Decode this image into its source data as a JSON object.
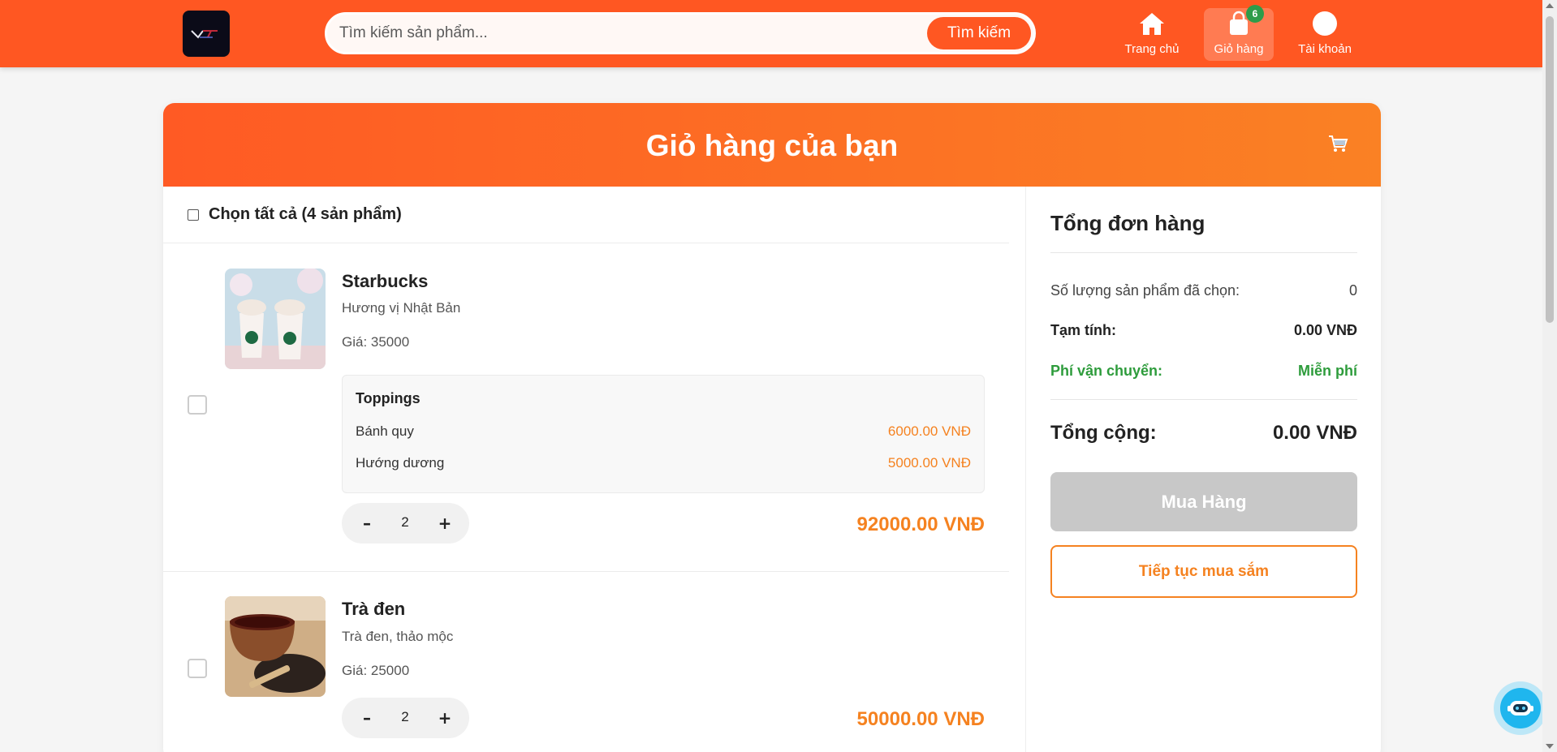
{
  "header": {
    "search": {
      "placeholder": "Tìm kiếm sản phẩm...",
      "button_label": "Tìm kiếm"
    },
    "nav": [
      {
        "label": "Trang chủ",
        "icon": "home-icon"
      },
      {
        "label": "Giỏ hàng",
        "icon": "shopping-bag-icon",
        "badge": "6"
      },
      {
        "label": "Tài khoản",
        "icon": "account-icon"
      }
    ],
    "brand_color": "#ff5722"
  },
  "cart": {
    "title": "Giỏ hàng của bạn",
    "select_all_label": "Chọn tất cả (4 sản phẩm)",
    "items": [
      {
        "name": "Starbucks",
        "description": "Hương vị Nhật Bản",
        "price_label": "Giá: 35000",
        "toppings_title": "Toppings",
        "toppings": [
          {
            "name": "Bánh quy",
            "price": "6000.00 VNĐ"
          },
          {
            "name": "Hướng dương",
            "price": "5000.00 VNĐ"
          }
        ],
        "quantity": "2",
        "total": "92000.00 VNĐ"
      },
      {
        "name": "Trà đen",
        "description": "Trà đen, thảo mộc",
        "price_label": "Giá: 25000",
        "quantity": "2",
        "total": "50000.00 VNĐ"
      }
    ],
    "qty_minus": "–",
    "qty_plus": "+",
    "accent_color": "#f58220"
  },
  "summary": {
    "title": "Tổng đơn hàng",
    "selected_count_label": "Số lượng sản phẩm đã chọn:",
    "selected_count": "0",
    "subtotal_label": "Tạm tính:",
    "subtotal": "0.00 VNĐ",
    "shipping_label": "Phí vận chuyển:",
    "shipping": "Miễn phí",
    "total_label": "Tổng cộng:",
    "total": "0.00 VNĐ",
    "buy_button": "Mua Hàng",
    "continue_button": "Tiếp tục mua sắm",
    "shipping_color": "#2e9c3c"
  }
}
